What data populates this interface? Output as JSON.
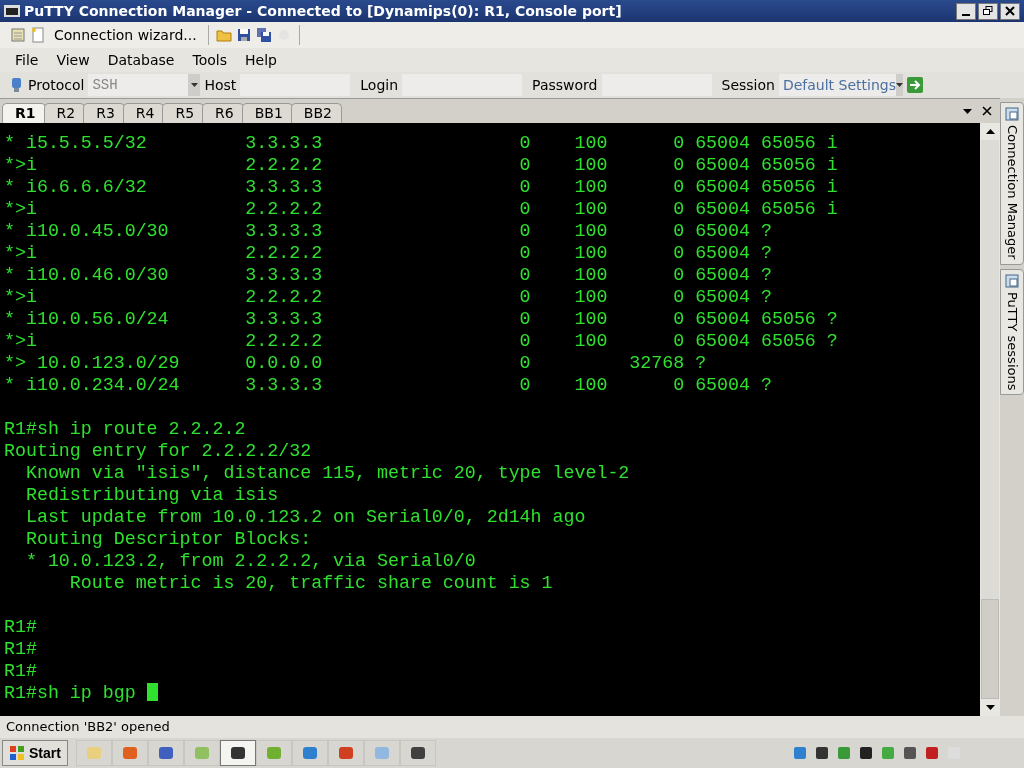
{
  "window": {
    "title": "PuTTY Connection Manager - Connected to [Dynamips(0): R1, Console port]"
  },
  "toolbar": {
    "wizard": "Connection wizard..."
  },
  "menu": [
    "File",
    "View",
    "Database",
    "Tools",
    "Help"
  ],
  "connection_bar": {
    "protocol_label": "Protocol",
    "protocol": "SSH",
    "host_label": "Host",
    "login_label": "Login",
    "password_label": "Password",
    "session_label": "Session",
    "session": "Default Settings"
  },
  "tabs": [
    {
      "label": "R1",
      "selected": true
    },
    {
      "label": "R2",
      "selected": false
    },
    {
      "label": "R3",
      "selected": false
    },
    {
      "label": "R4",
      "selected": false
    },
    {
      "label": "R5",
      "selected": false
    },
    {
      "label": "R6",
      "selected": false
    },
    {
      "label": "BB1",
      "selected": false
    },
    {
      "label": "BB2",
      "selected": false
    }
  ],
  "terminal": {
    "blocks": [
      [
        "* i5.5.5.5/32         3.3.3.3                  0    100      0 65004 65056 i",
        "*>i                   2.2.2.2                  0    100      0 65004 65056 i",
        "* i6.6.6.6/32         3.3.3.3                  0    100      0 65004 65056 i",
        "*>i                   2.2.2.2                  0    100      0 65004 65056 i",
        "* i10.0.45.0/30       3.3.3.3                  0    100      0 65004 ?",
        "*>i                   2.2.2.2                  0    100      0 65004 ?",
        "* i10.0.46.0/30       3.3.3.3                  0    100      0 65004 ?",
        "*>i                   2.2.2.2                  0    100      0 65004 ?",
        "* i10.0.56.0/24       3.3.3.3                  0    100      0 65004 65056 ?",
        "*>i                   2.2.2.2                  0    100      0 65004 65056 ?",
        "*> 10.0.123.0/29      0.0.0.0                  0         32768 ?",
        "* i10.0.234.0/24      3.3.3.3                  0    100      0 65004 ?"
      ],
      [
        "R1#sh ip route 2.2.2.2",
        "Routing entry for 2.2.2.2/32",
        "  Known via \"isis\", distance 115, metric 20, type level-2",
        "  Redistributing via isis",
        "  Last update from 10.0.123.2 on Serial0/0, 2d14h ago",
        "  Routing Descriptor Blocks:",
        "  * 10.0.123.2, from 2.2.2.2, via Serial0/0",
        "      Route metric is 20, traffic share count is 1"
      ],
      [
        "R1#",
        "R1#",
        "R1#"
      ]
    ],
    "prompt": "R1#sh ip bgp "
  },
  "side_tabs": [
    "Connection Manager",
    "PuTTY sessions"
  ],
  "status_bar": "Connection 'BB2' opened",
  "taskbar": {
    "start": "Start"
  }
}
